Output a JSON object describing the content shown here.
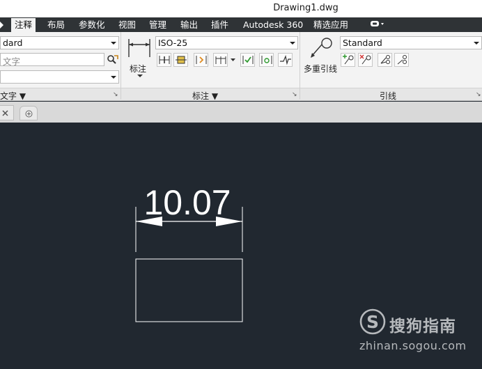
{
  "window": {
    "title": "Drawing1.dwg"
  },
  "tabs": [
    {
      "label": "注释",
      "active": true
    },
    {
      "label": "布局"
    },
    {
      "label": "参数化"
    },
    {
      "label": "视图"
    },
    {
      "label": "管理"
    },
    {
      "label": "输出"
    },
    {
      "label": "插件"
    },
    {
      "label": "Autodesk 360"
    },
    {
      "label": "精选应用"
    }
  ],
  "text_panel": {
    "style_value": "dard",
    "search_placeholder": "文字",
    "footer_label": "文字 ▼",
    "launcher": "↘"
  },
  "dimension_panel": {
    "big_button_label": "标注",
    "style_value": "ISO-25",
    "footer_label": "标注 ▼",
    "launcher": "↘"
  },
  "leader_panel": {
    "big_button_label": "多重引线",
    "style_value": "Standard",
    "footer_label": "引线",
    "launcher": "↘"
  },
  "drawing": {
    "dimension_text": "10.07",
    "colors": {
      "background": "#212830",
      "lines": "#ffffff"
    }
  },
  "watermark": {
    "logo_letter": "S",
    "brand": "搜狗指南",
    "url": "zhinan.sogou.com"
  }
}
